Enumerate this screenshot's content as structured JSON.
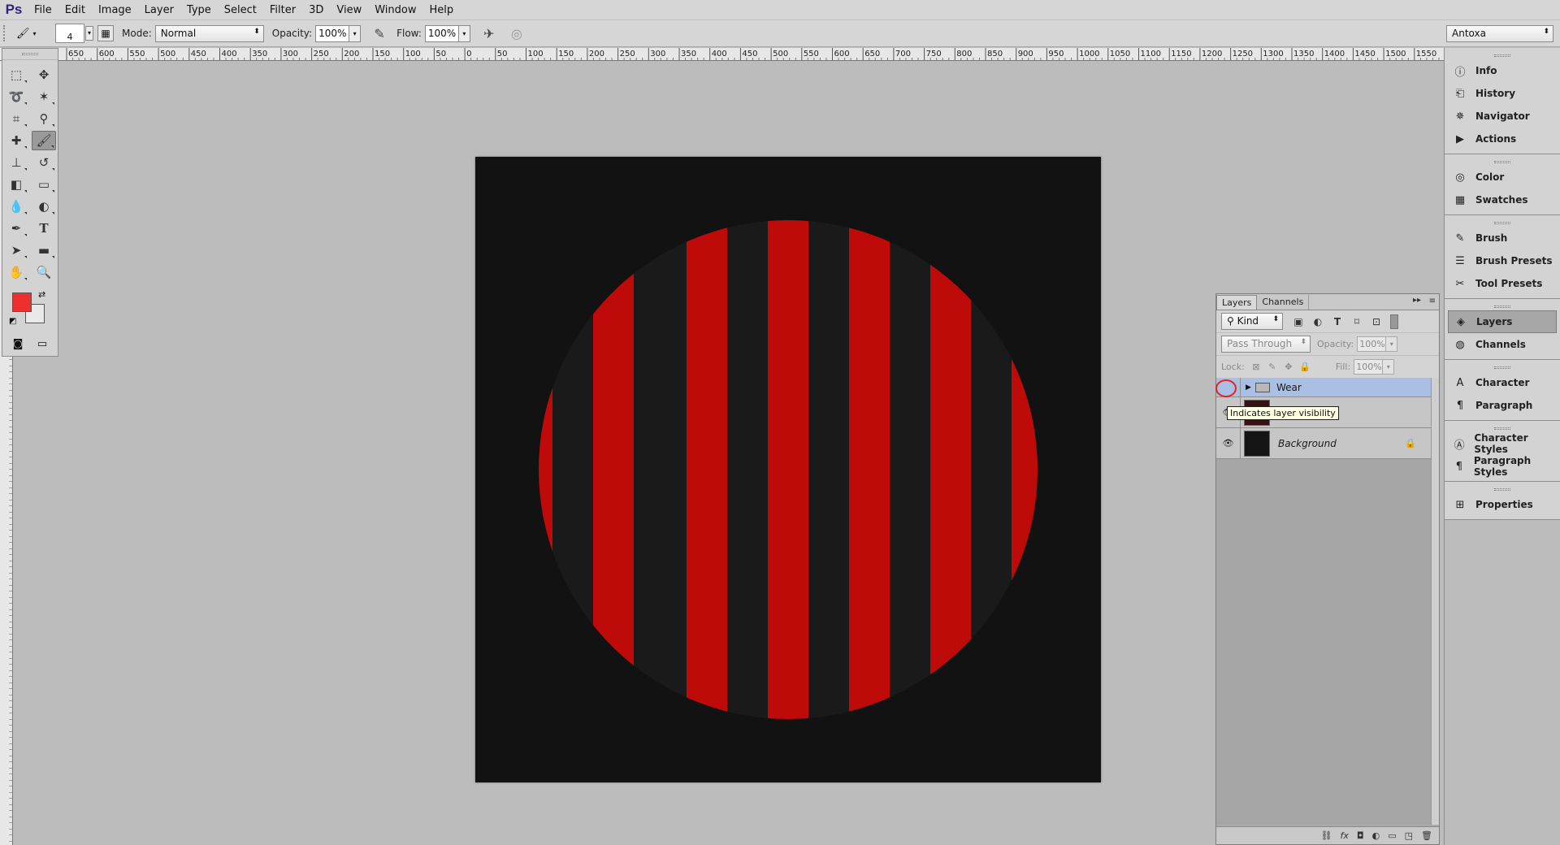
{
  "menu": {
    "logo": "Ps",
    "items": [
      "File",
      "Edit",
      "Image",
      "Layer",
      "Type",
      "Select",
      "Filter",
      "3D",
      "View",
      "Window",
      "Help"
    ]
  },
  "options": {
    "brush_size": "4",
    "mode_label": "Mode:",
    "mode_value": "Normal",
    "opacity_label": "Opacity:",
    "opacity_value": "100%",
    "flow_label": "Flow:",
    "flow_value": "100%",
    "workspace_value": "Antoxa"
  },
  "ruler": {
    "top_labels": [
      "650",
      "600",
      "550",
      "500",
      "450",
      "400",
      "350",
      "300",
      "250",
      "200",
      "150",
      "100",
      "50",
      "0",
      "50",
      "100",
      "150",
      "200",
      "250",
      "300",
      "350",
      "400",
      "450",
      "500",
      "550",
      "600",
      "650",
      "700",
      "750",
      "800",
      "850",
      "900",
      "950",
      "1000",
      "1050",
      "1100",
      "1150",
      "1200",
      "1250",
      "1300",
      "1350",
      "1400",
      "1450",
      "1500",
      "1550"
    ]
  },
  "tools": {
    "icons": [
      "marquee-icon",
      "move-icon",
      "lasso-icon",
      "magic-wand-icon",
      "crop-icon",
      "eyedropper-icon",
      "healing-icon",
      "brush-icon",
      "stamp-icon",
      "history-brush-icon",
      "eraser-icon",
      "gradient-icon",
      "blur-icon",
      "dodge-icon",
      "pen-icon",
      "type-icon",
      "path-select-icon",
      "rectangle-icon",
      "hand-icon",
      "zoom-icon"
    ],
    "active": "brush-icon",
    "foreground_color": "#ed2f2f",
    "background_color": "#e9e9e9"
  },
  "canvas": {
    "background": "#121212",
    "circle_fill": "#1a1a1a",
    "stripe_color": "#bf0a0a",
    "stripe_count": 6
  },
  "layers_panel": {
    "tabs": [
      "Layers",
      "Channels"
    ],
    "active_tab": "Layers",
    "kind_label": "Kind",
    "blend_mode": "Pass Through",
    "opacity_label": "Opacity:",
    "opacity_value": "100%",
    "lock_label": "Lock:",
    "fill_label": "Fill:",
    "fill_value": "100%",
    "layers": [
      {
        "name": "Wear",
        "type": "group",
        "selected": true
      },
      {
        "name": "",
        "type": "pixel",
        "selected": false
      },
      {
        "name": "Background",
        "type": "background",
        "selected": false
      }
    ],
    "tooltip": "Indicates layer visibility"
  },
  "dock": {
    "groups": [
      [
        {
          "label": "Info",
          "icon": "info-icon"
        },
        {
          "label": "History",
          "icon": "history-icon"
        },
        {
          "label": "Navigator",
          "icon": "navigator-icon"
        },
        {
          "label": "Actions",
          "icon": "actions-icon"
        }
      ],
      [
        {
          "label": "Color",
          "icon": "color-icon"
        },
        {
          "label": "Swatches",
          "icon": "swatches-icon"
        }
      ],
      [
        {
          "label": "Brush",
          "icon": "brush-panel-icon"
        },
        {
          "label": "Brush Presets",
          "icon": "brush-presets-icon"
        },
        {
          "label": "Tool Presets",
          "icon": "tool-presets-icon"
        }
      ],
      [
        {
          "label": "Layers",
          "icon": "layers-icon",
          "active": true
        },
        {
          "label": "Channels",
          "icon": "channels-icon"
        }
      ],
      [
        {
          "label": "Character",
          "icon": "character-icon"
        },
        {
          "label": "Paragraph",
          "icon": "paragraph-icon"
        }
      ],
      [
        {
          "label": "Character Styles",
          "icon": "character-styles-icon"
        },
        {
          "label": "Paragraph Styles",
          "icon": "paragraph-styles-icon"
        }
      ],
      [
        {
          "label": "Properties",
          "icon": "properties-icon"
        }
      ]
    ]
  }
}
